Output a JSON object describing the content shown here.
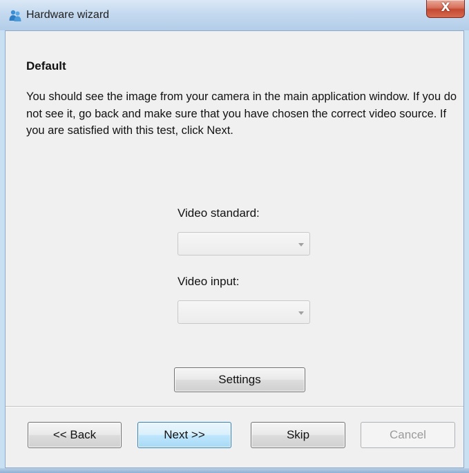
{
  "window": {
    "title": "Hardware wizard",
    "close_label": "X"
  },
  "page": {
    "heading": "Default",
    "description": "You should see the image from your camera in the main application window.  If you do not see it, go back and make sure that you have chosen the correct video source.  If you are satisfied with this test, click Next."
  },
  "video_standard": {
    "label": "Video standard:",
    "value": "",
    "enabled": false
  },
  "video_input": {
    "label": "Video input:",
    "value": "",
    "enabled": false
  },
  "settings_button": {
    "label": "Settings"
  },
  "footer": {
    "back_label": "<< Back",
    "next_label": "Next >>",
    "skip_label": "Skip",
    "cancel_label": "Cancel",
    "cancel_enabled": false
  },
  "colors": {
    "titlebar": "#c4d9ef",
    "client_background": "#f0f0f0",
    "close_button": "#c34a33",
    "next_button_accent": "#bee6fd"
  }
}
